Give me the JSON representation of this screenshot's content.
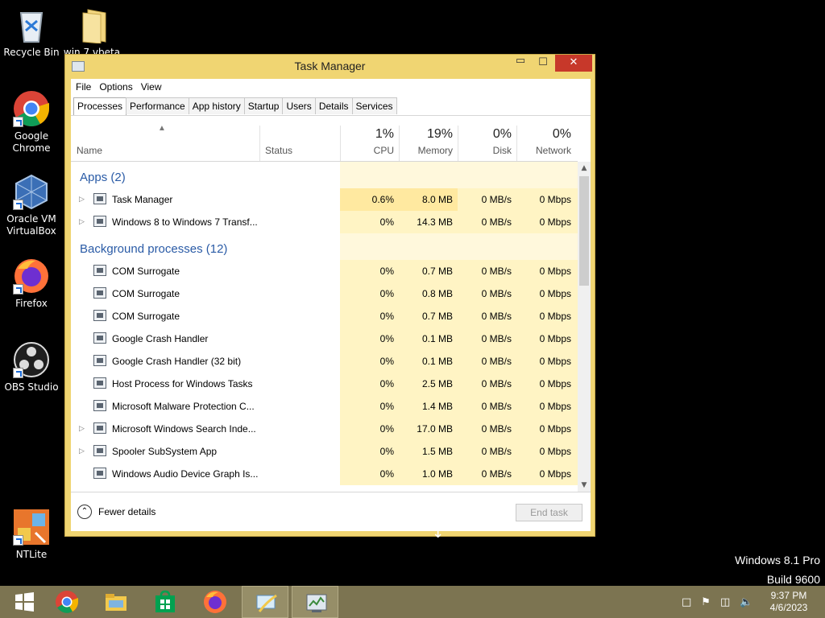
{
  "desktop_icons": [
    {
      "label": "Recycle Bin",
      "icon": "recycle-bin-icon"
    },
    {
      "label": "win 7 vbeta",
      "icon": "folder-icon"
    },
    {
      "label": "Google Chrome",
      "icon": "chrome-icon"
    },
    {
      "label": "Oracle VM VirtualBox",
      "icon": "virtualbox-icon"
    },
    {
      "label": "Firefox",
      "icon": "firefox-icon"
    },
    {
      "label": "OBS Studio",
      "icon": "obs-icon"
    },
    {
      "label": "NTLite",
      "icon": "ntlite-icon"
    }
  ],
  "window": {
    "title": "Task Manager",
    "minimize": "▭",
    "maximize": "☐",
    "close": "✕"
  },
  "menu": [
    "File",
    "Options",
    "View"
  ],
  "tabs": [
    "Processes",
    "Performance",
    "App history",
    "Startup",
    "Users",
    "Details",
    "Services"
  ],
  "columns": {
    "name": "Name",
    "status": "Status",
    "cpu": {
      "label": "CPU",
      "pct": "1%"
    },
    "memory": {
      "label": "Memory",
      "pct": "19%"
    },
    "disk": {
      "label": "Disk",
      "pct": "0%"
    },
    "network": {
      "label": "Network",
      "pct": "0%"
    }
  },
  "groups": {
    "apps": "Apps (2)",
    "background": "Background processes (12)"
  },
  "apps": [
    {
      "name": "Task Manager",
      "cpu": "0.6%",
      "mem": "8.0 MB",
      "disk": "0 MB/s",
      "net": "0 Mbps",
      "expand": true
    },
    {
      "name": "Windows 8 to Windows 7 Transf...",
      "cpu": "0%",
      "mem": "14.3 MB",
      "disk": "0 MB/s",
      "net": "0 Mbps",
      "expand": true
    }
  ],
  "background": [
    {
      "name": "COM Surrogate",
      "cpu": "0%",
      "mem": "0.7 MB",
      "disk": "0 MB/s",
      "net": "0 Mbps",
      "expand": false
    },
    {
      "name": "COM Surrogate",
      "cpu": "0%",
      "mem": "0.8 MB",
      "disk": "0 MB/s",
      "net": "0 Mbps",
      "expand": false
    },
    {
      "name": "COM Surrogate",
      "cpu": "0%",
      "mem": "0.7 MB",
      "disk": "0 MB/s",
      "net": "0 Mbps",
      "expand": false
    },
    {
      "name": "Google Crash Handler",
      "cpu": "0%",
      "mem": "0.1 MB",
      "disk": "0 MB/s",
      "net": "0 Mbps",
      "expand": false
    },
    {
      "name": "Google Crash Handler (32 bit)",
      "cpu": "0%",
      "mem": "0.1 MB",
      "disk": "0 MB/s",
      "net": "0 Mbps",
      "expand": false
    },
    {
      "name": "Host Process for Windows Tasks",
      "cpu": "0%",
      "mem": "2.5 MB",
      "disk": "0 MB/s",
      "net": "0 Mbps",
      "expand": false
    },
    {
      "name": "Microsoft Malware Protection C...",
      "cpu": "0%",
      "mem": "1.4 MB",
      "disk": "0 MB/s",
      "net": "0 Mbps",
      "expand": false
    },
    {
      "name": "Microsoft Windows Search Inde...",
      "cpu": "0%",
      "mem": "17.0 MB",
      "disk": "0 MB/s",
      "net": "0 Mbps",
      "expand": true
    },
    {
      "name": "Spooler SubSystem App",
      "cpu": "0%",
      "mem": "1.5 MB",
      "disk": "0 MB/s",
      "net": "0 Mbps",
      "expand": true
    },
    {
      "name": "Windows Audio Device Graph Is...",
      "cpu": "0%",
      "mem": "1.0 MB",
      "disk": "0 MB/s",
      "net": "0 Mbps",
      "expand": false
    }
  ],
  "footer": {
    "fewer_details": "Fewer details",
    "end_task": "End task"
  },
  "watermark": {
    "line1": "Windows 8.1 Pro",
    "line2": "Build 9600"
  },
  "taskbar": {
    "items": [
      "windows-start-icon",
      "chrome-icon",
      "file-explorer-icon",
      "store-icon",
      "firefox-icon",
      "transfer-icon",
      "task-manager-icon"
    ],
    "clock_time": "9:37 PM",
    "clock_date": "4/6/2023"
  },
  "colors": {
    "window_frame": "#f0d572",
    "taskbar": "#7c7451",
    "group_text": "#2a5ba6",
    "close_button": "#c7382a"
  }
}
